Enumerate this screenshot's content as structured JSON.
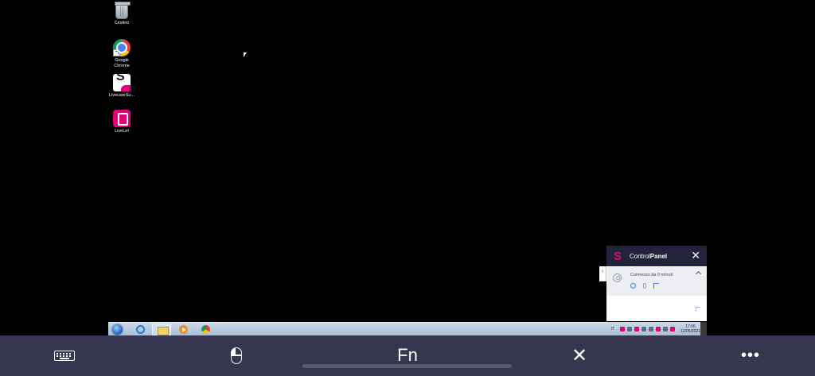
{
  "desktop": {
    "icons": [
      {
        "label": "Cestino",
        "icon": "recycle-bin-icon"
      },
      {
        "label": "Google Chrome",
        "icon": "chrome-icon"
      },
      {
        "label": "LivecareSu...",
        "icon": "livecare-icon"
      },
      {
        "label": "LiveLet",
        "icon": "livelet-icon"
      }
    ]
  },
  "taskbar": {
    "apps": [
      "start-orb-icon",
      "internet-explorer-icon",
      "file-explorer-icon",
      "media-player-icon",
      "chrome-icon"
    ],
    "tray_lang": "IT",
    "clock_time": "17:06",
    "clock_date": "12/05/2021"
  },
  "control_panel": {
    "logo": "S",
    "title_prefix": "Control",
    "title_bold": "Panel",
    "close_glyph": "✕",
    "status": "Connesso da 0 minuti",
    "collapse_glyph": "›"
  },
  "bottom_bar": {
    "fn_label": "Fn",
    "close_glyph": "✕",
    "more_glyph": "•••"
  },
  "colors": {
    "accent": "#e4007c",
    "panel_header": "#22223a",
    "bottom_bar": "#363650"
  }
}
